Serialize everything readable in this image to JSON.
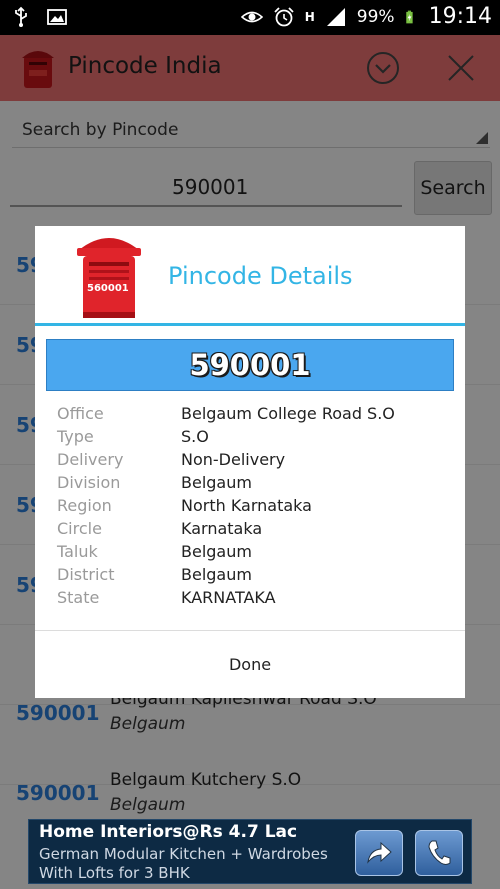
{
  "status_bar": {
    "battery": "99%",
    "time": "19:14",
    "signal_label": "H"
  },
  "app": {
    "title": "Pincode India"
  },
  "search": {
    "mode": "Search by Pincode",
    "input_value": "590001",
    "button": "Search"
  },
  "list": {
    "rows": [
      {
        "pin": "590001",
        "office": "",
        "district": ""
      },
      {
        "pin": "590001",
        "office": "",
        "district": ""
      },
      {
        "pin": "590001",
        "office": "",
        "district": ""
      },
      {
        "pin": "590001",
        "office": "",
        "district": ""
      },
      {
        "pin": "590001",
        "office": "",
        "district": ""
      },
      {
        "pin": "590001",
        "office": "Belgaum Kapileshwar Road S.O",
        "district": "Belgaum"
      },
      {
        "pin": "590001",
        "office": "Belgaum Kutchery S.O",
        "district": "Belgaum"
      }
    ]
  },
  "dialog": {
    "title": "Pincode Details",
    "icon_text": "560001",
    "pincode": "590001",
    "details": [
      {
        "label": "Office",
        "value": "Belgaum College Road S.O"
      },
      {
        "label": "Type",
        "value": "S.O"
      },
      {
        "label": "Delivery",
        "value": "Non-Delivery"
      },
      {
        "label": "Division",
        "value": "Belgaum"
      },
      {
        "label": "Region",
        "value": "North Karnataka"
      },
      {
        "label": "Circle",
        "value": "Karnataka"
      },
      {
        "label": "Taluk",
        "value": "Belgaum"
      },
      {
        "label": "District",
        "value": "Belgaum"
      },
      {
        "label": "State",
        "value": "KARNATAKA"
      }
    ],
    "done": "Done"
  },
  "ad": {
    "title": "Home Interiors@Rs 4.7 Lac",
    "subtitle": "German Modular Kitchen + Wardrobes With Lofts for 3 BHK"
  },
  "colors": {
    "action_bar": "#e56e6e",
    "accent": "#33b5e5",
    "pin_banner": "#4aa7ef",
    "pin_list": "#2a7bd3",
    "ad_bg": "#0d2a44"
  }
}
